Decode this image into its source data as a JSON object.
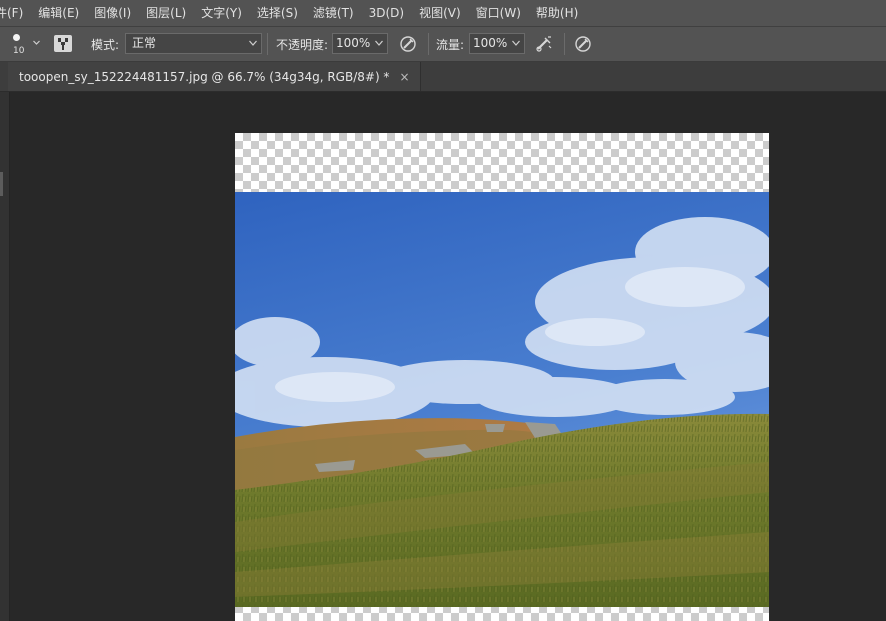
{
  "menubar": {
    "items": [
      {
        "label": "件(F)"
      },
      {
        "label": "编辑(E)"
      },
      {
        "label": "图像(I)"
      },
      {
        "label": "图层(L)"
      },
      {
        "label": "文字(Y)"
      },
      {
        "label": "选择(S)"
      },
      {
        "label": "滤镜(T)"
      },
      {
        "label": "3D(D)"
      },
      {
        "label": "视图(V)"
      },
      {
        "label": "窗口(W)"
      },
      {
        "label": "帮助(H)"
      }
    ]
  },
  "options": {
    "brush_size": "10",
    "mode_label": "模式:",
    "mode_value": "正常",
    "opacity_label": "不透明度:",
    "opacity_value": "100%",
    "flow_label": "流量:",
    "flow_value": "100%"
  },
  "document": {
    "tab_title": "tooopen_sy_152224481157.jpg @ 66.7% (34g34g, RGB/8#) *",
    "close_glyph": "×"
  },
  "colors": {
    "app_bg": "#282828",
    "bar_bg": "#535353",
    "sky": "#3f74c9",
    "grass": "#6f7c2c"
  }
}
